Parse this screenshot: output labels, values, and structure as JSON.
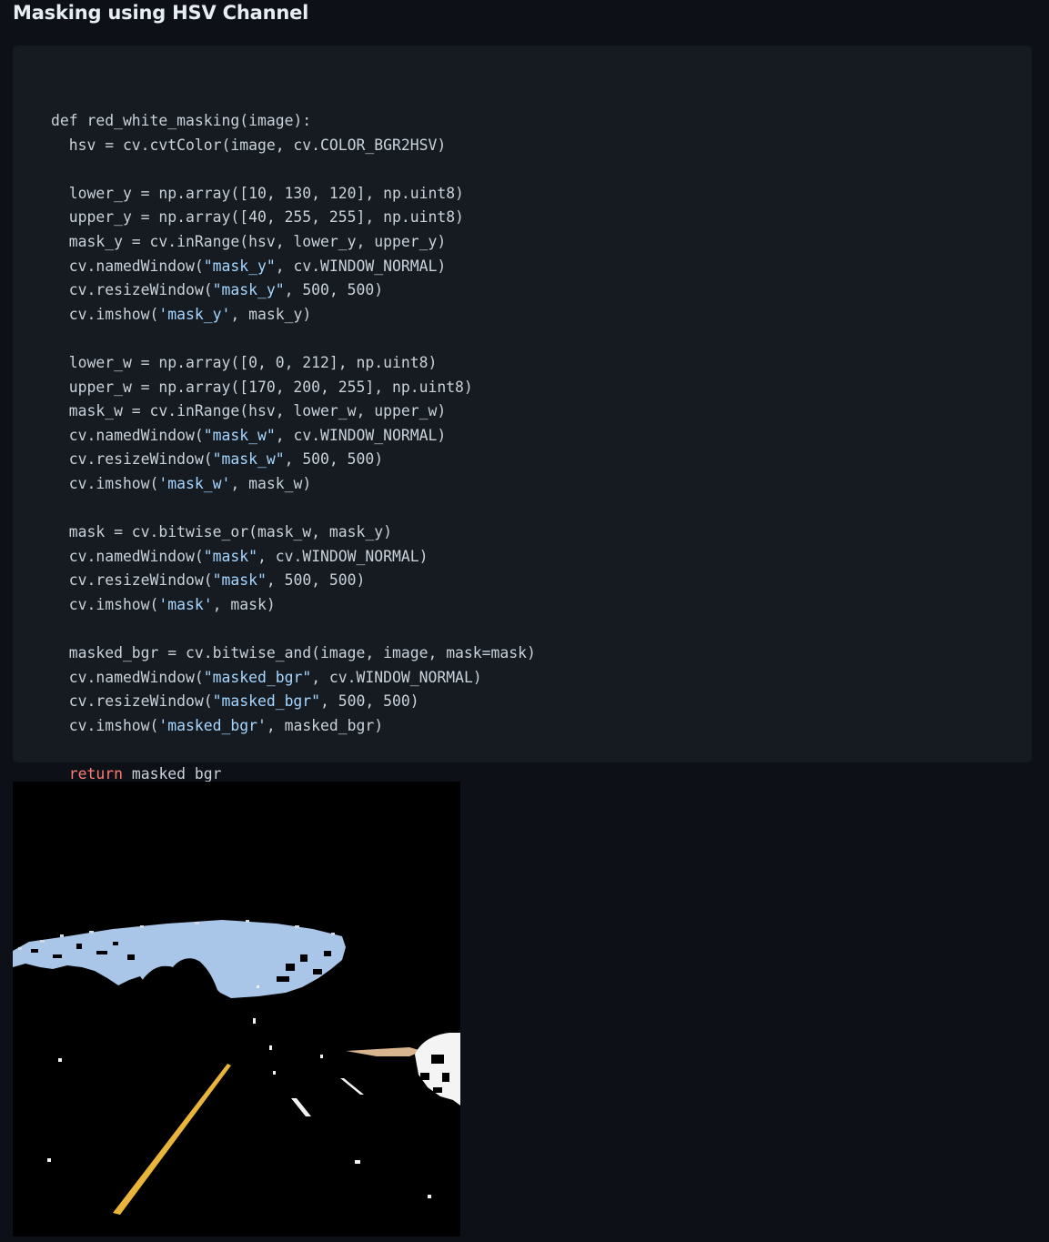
{
  "heading": "Masking using HSV Channel",
  "code": {
    "lines": [
      [
        {
          "t": "def red_white_masking(image):",
          "c": "plain"
        }
      ],
      [
        {
          "t": "  hsv = cv.cvtColor(image, cv.COLOR_BGR2HSV)",
          "c": "plain"
        }
      ],
      [
        {
          "t": "",
          "c": "plain"
        }
      ],
      [
        {
          "t": "  lower_y = np.array([10, 130, 120], np.uint8)",
          "c": "plain"
        }
      ],
      [
        {
          "t": "  upper_y = np.array([40, 255, 255], np.uint8)",
          "c": "plain"
        }
      ],
      [
        {
          "t": "  mask_y = cv.inRange(hsv, lower_y, upper_y)",
          "c": "plain"
        }
      ],
      [
        {
          "t": "  cv.namedWindow(",
          "c": "plain"
        },
        {
          "t": "\"mask_y\"",
          "c": "str"
        },
        {
          "t": ", cv.WINDOW_NORMAL)",
          "c": "plain"
        }
      ],
      [
        {
          "t": "  cv.resizeWindow(",
          "c": "plain"
        },
        {
          "t": "\"mask_y\"",
          "c": "str"
        },
        {
          "t": ", 500, 500)",
          "c": "plain"
        }
      ],
      [
        {
          "t": "  cv.imshow(",
          "c": "plain"
        },
        {
          "t": "'mask_y'",
          "c": "str"
        },
        {
          "t": ", mask_y)",
          "c": "plain"
        }
      ],
      [
        {
          "t": "",
          "c": "plain"
        }
      ],
      [
        {
          "t": "  lower_w = np.array([0, 0, 212], np.uint8)",
          "c": "plain"
        }
      ],
      [
        {
          "t": "  upper_w = np.array([170, 200, 255], np.uint8)",
          "c": "plain"
        }
      ],
      [
        {
          "t": "  mask_w = cv.inRange(hsv, lower_w, upper_w)",
          "c": "plain"
        }
      ],
      [
        {
          "t": "  cv.namedWindow(",
          "c": "plain"
        },
        {
          "t": "\"mask_w\"",
          "c": "str"
        },
        {
          "t": ", cv.WINDOW_NORMAL)",
          "c": "plain"
        }
      ],
      [
        {
          "t": "  cv.resizeWindow(",
          "c": "plain"
        },
        {
          "t": "\"mask_w\"",
          "c": "str"
        },
        {
          "t": ", 500, 500)",
          "c": "plain"
        }
      ],
      [
        {
          "t": "  cv.imshow(",
          "c": "plain"
        },
        {
          "t": "'mask_w'",
          "c": "str"
        },
        {
          "t": ", mask_w)",
          "c": "plain"
        }
      ],
      [
        {
          "t": "",
          "c": "plain"
        }
      ],
      [
        {
          "t": "  mask = cv.bitwise_or(mask_w, mask_y)",
          "c": "plain"
        }
      ],
      [
        {
          "t": "  cv.namedWindow(",
          "c": "plain"
        },
        {
          "t": "\"mask\"",
          "c": "str"
        },
        {
          "t": ", cv.WINDOW_NORMAL)",
          "c": "plain"
        }
      ],
      [
        {
          "t": "  cv.resizeWindow(",
          "c": "plain"
        },
        {
          "t": "\"mask\"",
          "c": "str"
        },
        {
          "t": ", 500, 500)",
          "c": "plain"
        }
      ],
      [
        {
          "t": "  cv.imshow(",
          "c": "plain"
        },
        {
          "t": "'mask'",
          "c": "str"
        },
        {
          "t": ", mask)",
          "c": "plain"
        }
      ],
      [
        {
          "t": "",
          "c": "plain"
        }
      ],
      [
        {
          "t": "  masked_bgr = cv.bitwise_and(image, image, mask=mask)",
          "c": "plain"
        }
      ],
      [
        {
          "t": "  cv.namedWindow(",
          "c": "plain"
        },
        {
          "t": "\"masked_bgr\"",
          "c": "str"
        },
        {
          "t": ", cv.WINDOW_NORMAL)",
          "c": "plain"
        }
      ],
      [
        {
          "t": "  cv.resizeWindow(",
          "c": "plain"
        },
        {
          "t": "\"masked_bgr\"",
          "c": "str"
        },
        {
          "t": ", 500, 500)",
          "c": "plain"
        }
      ],
      [
        {
          "t": "  cv.imshow(",
          "c": "plain"
        },
        {
          "t": "'masked_bgr'",
          "c": "str"
        },
        {
          "t": ", masked_bgr)",
          "c": "plain"
        }
      ],
      [
        {
          "t": "",
          "c": "plain"
        }
      ],
      [
        {
          "t": "  ",
          "c": "plain"
        },
        {
          "t": "return",
          "c": "kw"
        },
        {
          "t": " masked_bgr",
          "c": "plain"
        }
      ]
    ]
  },
  "colors": {
    "page_bg": "#0d1117",
    "code_bg": "#161b22",
    "code_text": "#c9d1d9",
    "string": "#a5d6ff",
    "keyword": "#ff7b72",
    "sky_mask": "#a9c6e8",
    "lane_yellow": "#e8b53a"
  },
  "image": {
    "name": "masked-road-output",
    "description_icon": "masked-road-image"
  }
}
